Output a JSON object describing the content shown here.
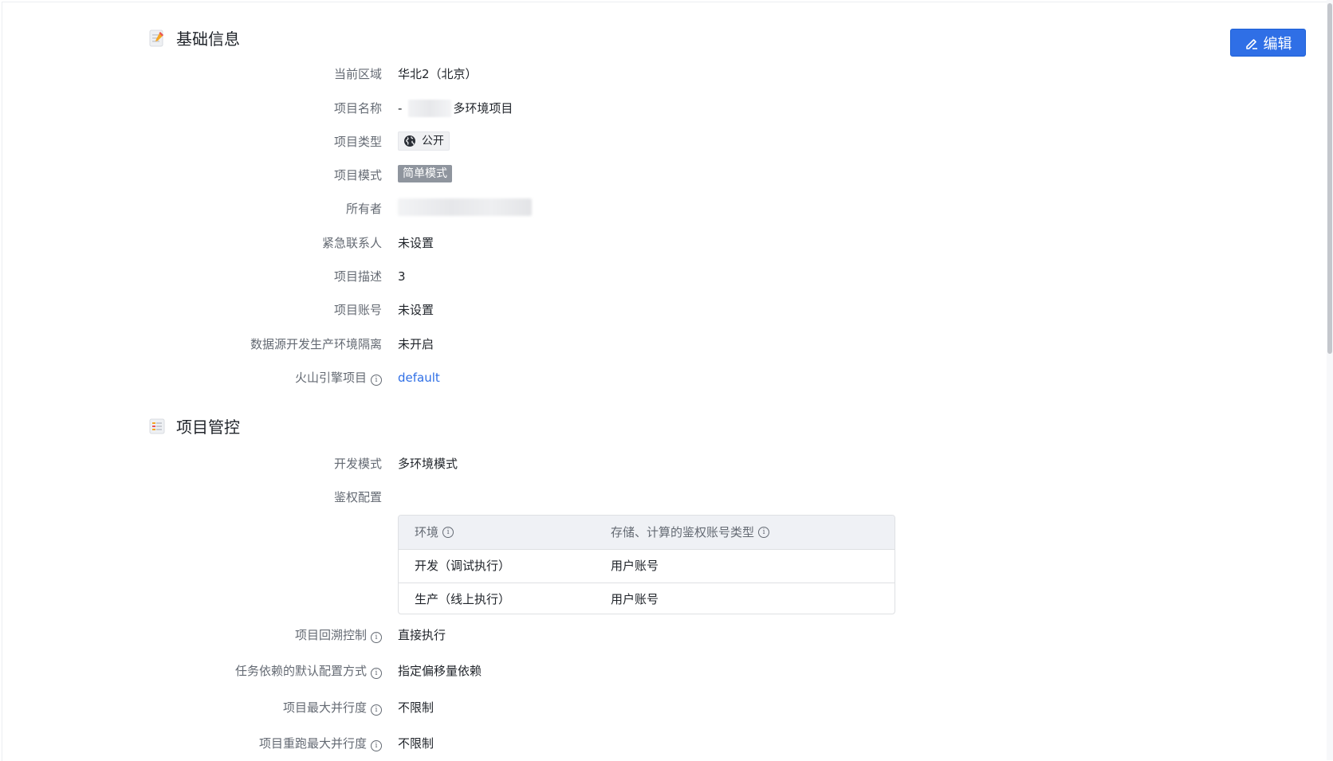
{
  "basic": {
    "title": "基础信息",
    "edit_label": "编辑",
    "rows": {
      "region": {
        "label": "当前区域",
        "value": "华北2（北京）"
      },
      "name": {
        "label": "项目名称",
        "prefix": "-",
        "value": "多环境项目"
      },
      "type": {
        "label": "项目类型",
        "value": "公开",
        "icon": "globe-icon"
      },
      "mode": {
        "label": "项目模式",
        "value": "简单模式"
      },
      "owner": {
        "label": "所有者"
      },
      "contact": {
        "label": "紧急联系人",
        "value": "未设置"
      },
      "desc": {
        "label": "项目描述",
        "value": "3"
      },
      "account": {
        "label": "项目账号",
        "value": "未设置"
      },
      "isolation": {
        "label": "数据源开发生产环境隔离",
        "value": "未开启"
      },
      "volc": {
        "label": "火山引擎项目",
        "value": "default",
        "info": "ⓘ"
      }
    }
  },
  "control": {
    "title": "项目管控",
    "rows": {
      "dev_mode": {
        "label": "开发模式",
        "value": "多环境模式"
      },
      "auth": {
        "label": "鉴权配置"
      },
      "backtrack": {
        "label": "项目回溯控制",
        "value": "直接执行"
      },
      "dependency": {
        "label": "任务依赖的默认配置方式",
        "value": "指定偏移量依赖"
      },
      "parallel": {
        "label": "项目最大并行度",
        "value": "不限制"
      },
      "rerun_parallel": {
        "label": "项目重跑最大并行度",
        "value": "不限制"
      }
    },
    "auth_table": {
      "headers": [
        "环境",
        "存储、计算的鉴权账号类型"
      ],
      "rows": [
        [
          "开发（调试执行）",
          "用户账号"
        ],
        [
          "生产（线上执行）",
          "用户账号"
        ]
      ]
    }
  },
  "colors": {
    "accent": "#2f6fe6",
    "label": "#646a73",
    "text": "#1f2329",
    "tag_mode": "#8f959e"
  }
}
